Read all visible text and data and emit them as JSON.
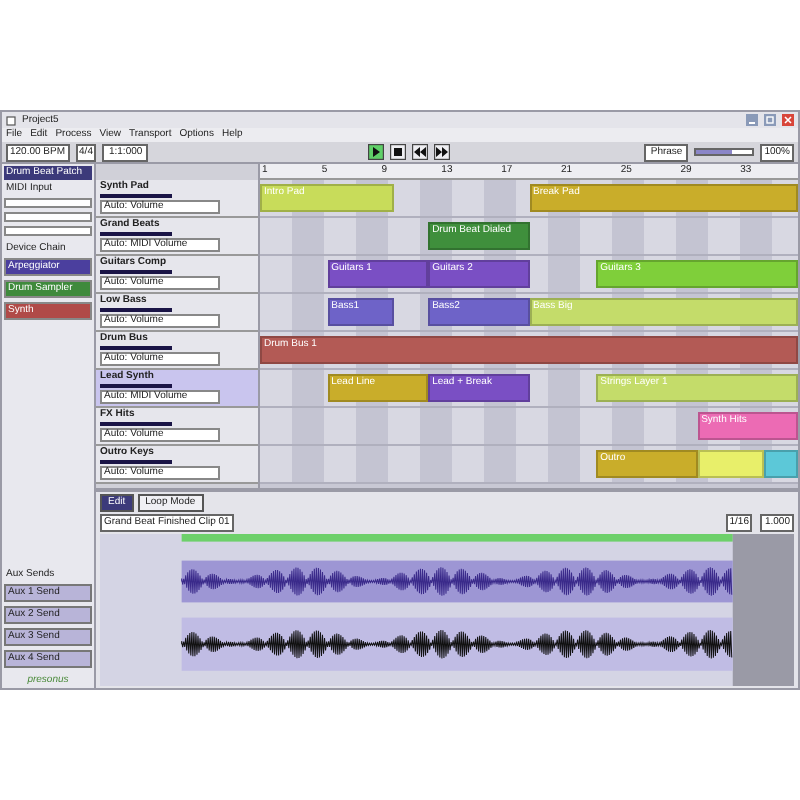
{
  "window": {
    "title": "Project5"
  },
  "menu": [
    "File",
    "Edit",
    "Process",
    "View",
    "Transport",
    "Options",
    "Help"
  ],
  "toolbar": {
    "tempo": "120.00 BPM",
    "meter": "4/4",
    "position": "1:1:000",
    "snap": "Phrase",
    "zoom_slider": {
      "level": 0.65
    },
    "zoom": "100%"
  },
  "transport": [
    {
      "kind": "play",
      "selected": true
    },
    {
      "kind": "stop",
      "selected": false
    },
    {
      "kind": "rewind",
      "selected": false
    },
    {
      "kind": "forward",
      "selected": false
    }
  ],
  "inspector": {
    "title": "Drum Beat Patch",
    "midi_input": "MIDI Input",
    "device_chain": "Device Chain",
    "devices": [
      {
        "name": "Arpeggiator",
        "color": "#4b3f9e"
      },
      {
        "name": "Drum Sampler",
        "color": "#3f8a3c"
      },
      {
        "name": "Synth",
        "color": "#b04a48"
      }
    ],
    "aux_title": "Aux Sends",
    "aux": [
      "Aux 1 Send",
      "Aux 2 Send",
      "Aux 3 Send",
      "Aux 4 Send"
    ]
  },
  "ruler": [
    "1",
    "5",
    "9",
    "13",
    "17",
    "21",
    "25",
    "29",
    "33"
  ],
  "tracks": [
    {
      "name": "Synth Pad",
      "auto": "Auto: Volume",
      "selected": false,
      "cells": [
        {
          "kind": "clip",
          "name": "Intro Pad",
          "color": "#c8dc5a"
        },
        {
          "kind": "more"
        },
        {
          "kind": "more"
        },
        {
          "kind": "more"
        },
        {
          "kind": "gap"
        },
        {
          "kind": "gap"
        },
        {
          "kind": "gap"
        },
        {
          "kind": "gap"
        },
        {
          "kind": "clip",
          "name": "Break Pad",
          "color": "#c9ad2a"
        },
        {
          "kind": "more"
        },
        {
          "kind": "more"
        },
        {
          "kind": "more"
        },
        {
          "kind": "more"
        },
        {
          "kind": "more"
        },
        {
          "kind": "more"
        },
        {
          "kind": "more"
        }
      ]
    },
    {
      "name": "Grand Beats",
      "auto": "Auto: MIDI Volume",
      "selected": false,
      "cells": [
        {
          "kind": "gap"
        },
        {
          "kind": "gap"
        },
        {
          "kind": "gap"
        },
        {
          "kind": "gap"
        },
        {
          "kind": "gap"
        },
        {
          "kind": "clip",
          "name": "Drum Beat Dialed",
          "color": "#3f8f3c"
        },
        {
          "kind": "more"
        },
        {
          "kind": "more"
        },
        {
          "kind": "gap"
        },
        {
          "kind": "gap"
        },
        {
          "kind": "gap"
        },
        {
          "kind": "gap"
        },
        {
          "kind": "gap"
        },
        {
          "kind": "gap"
        },
        {
          "kind": "gap"
        },
        {
          "kind": "gap"
        }
      ]
    },
    {
      "name": "Guitars Comp",
      "auto": "Auto: Volume",
      "selected": false,
      "cells": [
        {
          "kind": "gap"
        },
        {
          "kind": "gap"
        },
        {
          "kind": "clip",
          "name": "Guitars 1",
          "color": "#7a4fc4"
        },
        {
          "kind": "more"
        },
        {
          "kind": "more"
        },
        {
          "kind": "clip",
          "name": "Guitars 2",
          "color": "#7a4fc4"
        },
        {
          "kind": "more"
        },
        {
          "kind": "more"
        },
        {
          "kind": "gap"
        },
        {
          "kind": "gap"
        },
        {
          "kind": "clip",
          "name": "Guitars 3",
          "color": "#7fcf3a"
        },
        {
          "kind": "more"
        },
        {
          "kind": "more"
        },
        {
          "kind": "more"
        },
        {
          "kind": "more"
        },
        {
          "kind": "more"
        }
      ]
    },
    {
      "name": "Low Bass",
      "auto": "Auto: Volume",
      "selected": false,
      "cells": [
        {
          "kind": "gap"
        },
        {
          "kind": "gap"
        },
        {
          "kind": "clip",
          "name": "Bass1",
          "color": "#6e63c8"
        },
        {
          "kind": "more"
        },
        {
          "kind": "gap"
        },
        {
          "kind": "clip",
          "name": "Bass2",
          "color": "#6e63c8"
        },
        {
          "kind": "more"
        },
        {
          "kind": "more"
        },
        {
          "kind": "clip",
          "name": "Bass Big",
          "color": "#c4dc6a"
        },
        {
          "kind": "more"
        },
        {
          "kind": "more"
        },
        {
          "kind": "more"
        },
        {
          "kind": "more"
        },
        {
          "kind": "more"
        },
        {
          "kind": "more"
        },
        {
          "kind": "more"
        }
      ]
    },
    {
      "name": "Drum Bus",
      "auto": "Auto: Volume",
      "selected": false,
      "cells": [
        {
          "kind": "clip",
          "name": "Drum Bus 1",
          "color": "#b35a55"
        },
        {
          "kind": "more"
        },
        {
          "kind": "more"
        },
        {
          "kind": "more"
        },
        {
          "kind": "more"
        },
        {
          "kind": "more"
        },
        {
          "kind": "more"
        },
        {
          "kind": "more"
        },
        {
          "kind": "more"
        },
        {
          "kind": "more"
        },
        {
          "kind": "more"
        },
        {
          "kind": "more"
        },
        {
          "kind": "more"
        },
        {
          "kind": "more"
        },
        {
          "kind": "more"
        },
        {
          "kind": "more"
        }
      ]
    },
    {
      "name": "Lead Synth",
      "auto": "Auto: MIDI Volume",
      "selected": true,
      "cells": [
        {
          "kind": "gap"
        },
        {
          "kind": "gap"
        },
        {
          "kind": "clip",
          "name": "Lead Line",
          "color": "#c9ad2a"
        },
        {
          "kind": "more"
        },
        {
          "kind": "more"
        },
        {
          "kind": "clip",
          "name": "Lead + Break",
          "color": "#7a4fc4"
        },
        {
          "kind": "more"
        },
        {
          "kind": "more"
        },
        {
          "kind": "gap"
        },
        {
          "kind": "gap"
        },
        {
          "kind": "clip",
          "name": "Strings Layer 1",
          "color": "#c4dc6a"
        },
        {
          "kind": "more"
        },
        {
          "kind": "more"
        },
        {
          "kind": "more"
        },
        {
          "kind": "more"
        },
        {
          "kind": "more"
        }
      ]
    },
    {
      "name": "FX Hits",
      "auto": "Auto: Volume",
      "selected": false,
      "cells": [
        {
          "kind": "gap"
        },
        {
          "kind": "gap"
        },
        {
          "kind": "gap"
        },
        {
          "kind": "gap"
        },
        {
          "kind": "gap"
        },
        {
          "kind": "gap"
        },
        {
          "kind": "gap"
        },
        {
          "kind": "gap"
        },
        {
          "kind": "gap"
        },
        {
          "kind": "gap"
        },
        {
          "kind": "gap"
        },
        {
          "kind": "gap"
        },
        {
          "kind": "gap"
        },
        {
          "kind": "clip",
          "name": "Synth Hits",
          "color": "#ec6bb4"
        },
        {
          "kind": "more"
        },
        {
          "kind": "more"
        }
      ]
    },
    {
      "name": "Outro Keys",
      "auto": "Auto: Volume",
      "selected": false,
      "cells": [
        {
          "kind": "gap"
        },
        {
          "kind": "gap"
        },
        {
          "kind": "gap"
        },
        {
          "kind": "gap"
        },
        {
          "kind": "gap"
        },
        {
          "kind": "gap"
        },
        {
          "kind": "gap"
        },
        {
          "kind": "gap"
        },
        {
          "kind": "gap"
        },
        {
          "kind": "gap"
        },
        {
          "kind": "clip",
          "name": "Outro",
          "color": "#c9ad2a"
        },
        {
          "kind": "more"
        },
        {
          "kind": "more"
        },
        {
          "kind": "clip",
          "color": "#e8ef6a"
        },
        {
          "kind": "more"
        },
        {
          "kind": "clip",
          "color": "#5cc8d8"
        }
      ]
    }
  ],
  "editor": {
    "tabs": [
      {
        "label": "Edit",
        "selected": true
      },
      {
        "label": "Loop Mode",
        "selected": false
      }
    ],
    "clip": "Grand Beat Finished Clip 01",
    "snap": "1/16",
    "zoom": "1.000"
  },
  "logo": "presonus"
}
